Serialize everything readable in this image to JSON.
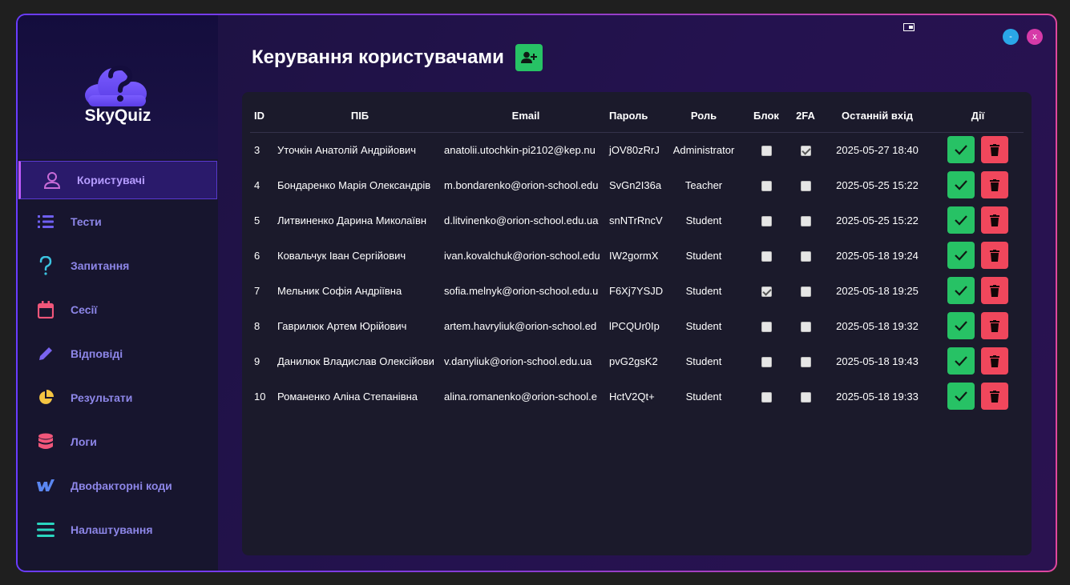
{
  "app": {
    "logo_text": "SkyQuiz"
  },
  "window_controls": {
    "minimize": "-",
    "close": "x"
  },
  "sidebar": {
    "items": [
      {
        "label": "Користувачі",
        "icon": "user-icon",
        "color": "#c86bd8",
        "active": true
      },
      {
        "label": "Тести",
        "icon": "list-icon",
        "color": "#6e5ff0"
      },
      {
        "label": "Запитання",
        "icon": "question-icon",
        "color": "#3bc3e0"
      },
      {
        "label": "Сесії",
        "icon": "calendar-icon",
        "color": "#f0567a"
      },
      {
        "label": "Відповіді",
        "icon": "pencil-icon",
        "color": "#7a64f0"
      },
      {
        "label": "Результати",
        "icon": "pie-chart-icon",
        "color": "#f5c542"
      },
      {
        "label": "Логи",
        "icon": "database-icon",
        "color": "#f0567a"
      },
      {
        "label": "Двофакторні коди",
        "icon": "webflow-icon",
        "color": "#5a86f0"
      },
      {
        "label": "Налаштування",
        "icon": "menu-icon",
        "color": "#2ad6c0"
      }
    ]
  },
  "main": {
    "title": "Керування користувачами"
  },
  "table": {
    "headers": [
      "ID",
      "ПІБ",
      "Email",
      "Пароль",
      "Роль",
      "Блок",
      "2FA",
      "Останній вхід",
      "Дії"
    ],
    "rows": [
      {
        "id": "3",
        "name": "Уточкін Анатолій Андрійович",
        "email": "anatolii.utochkin-pi2102@kep.nu",
        "password": "jOV80zRrJ",
        "role": "Administrator",
        "blocked": false,
        "twofa": true,
        "last": "2025-05-27 18:40"
      },
      {
        "id": "4",
        "name": "Бондаренко Марія Олександрів",
        "email": "m.bondarenko@orion-school.edu",
        "password": "SvGn2I36a",
        "role": "Teacher",
        "blocked": false,
        "twofa": false,
        "last": "2025-05-25 15:22"
      },
      {
        "id": "5",
        "name": "Литвиненко Дарина Миколаївн",
        "email": "d.litvinenko@orion-school.edu.ua",
        "password": "snNTrRncV",
        "role": "Student",
        "blocked": false,
        "twofa": false,
        "last": "2025-05-25 15:22"
      },
      {
        "id": "6",
        "name": "Ковальчук Іван Сергійович",
        "email": "ivan.kovalchuk@orion-school.edu",
        "password": "IW2gormX",
        "role": "Student",
        "blocked": false,
        "twofa": false,
        "last": "2025-05-18 19:24"
      },
      {
        "id": "7",
        "name": "Мельник Софія Андріївна",
        "email": "sofia.melnyk@orion-school.edu.u",
        "password": "F6Xj7YSJD",
        "role": "Student",
        "blocked": true,
        "twofa": false,
        "last": "2025-05-18 19:25"
      },
      {
        "id": "8",
        "name": "Гаврилюк Артем Юрійович",
        "email": "artem.havryliuk@orion-school.ed",
        "password": "lPCQUr0Ip",
        "role": "Student",
        "blocked": false,
        "twofa": false,
        "last": "2025-05-18 19:32"
      },
      {
        "id": "9",
        "name": "Данилюк Владислав Олексійови",
        "email": "v.danyliuk@orion-school.edu.ua",
        "password": "pvG2gsK2",
        "role": "Student",
        "blocked": false,
        "twofa": false,
        "last": "2025-05-18 19:43"
      },
      {
        "id": "10",
        "name": "Романенко Аліна Степанівна",
        "email": "alina.romanenko@orion-school.e",
        "password": "HctV2Qt+",
        "role": "Student",
        "blocked": false,
        "twofa": false,
        "last": "2025-05-18 19:33"
      }
    ]
  },
  "colors": {
    "accent_green": "#27c265",
    "accent_red": "#f0475c",
    "brand_purple": "#6a3cff"
  }
}
